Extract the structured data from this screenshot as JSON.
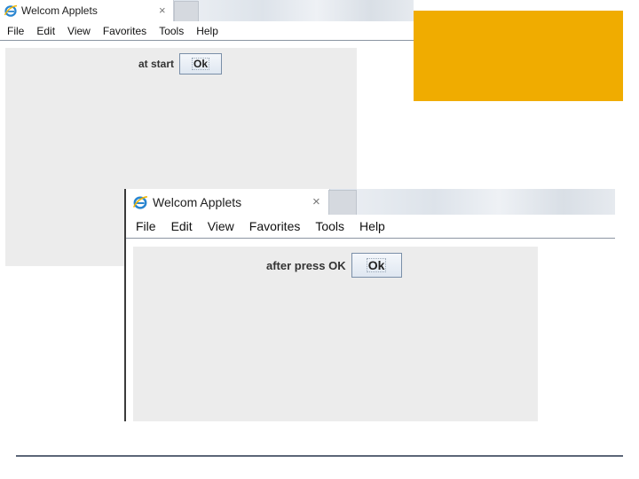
{
  "windows": [
    {
      "tab_title": "Welcom Applets",
      "tab_close": "×",
      "menu": [
        "File",
        "Edit",
        "View",
        "Favorites",
        "Tools",
        "Help"
      ],
      "applet": {
        "label": "at start",
        "button": "Ok"
      }
    },
    {
      "tab_title": "Welcom Applets",
      "tab_close": "×",
      "menu": [
        "File",
        "Edit",
        "View",
        "Favorites",
        "Tools",
        "Help"
      ],
      "applet": {
        "label": "after press OK",
        "button": "Ok"
      }
    }
  ],
  "icons": {
    "browser": "internet-explorer-icon",
    "close": "close-icon"
  },
  "colors": {
    "orange_block": "#f0ac00",
    "applet_bg": "#ececec",
    "rule": "#5c6678"
  }
}
